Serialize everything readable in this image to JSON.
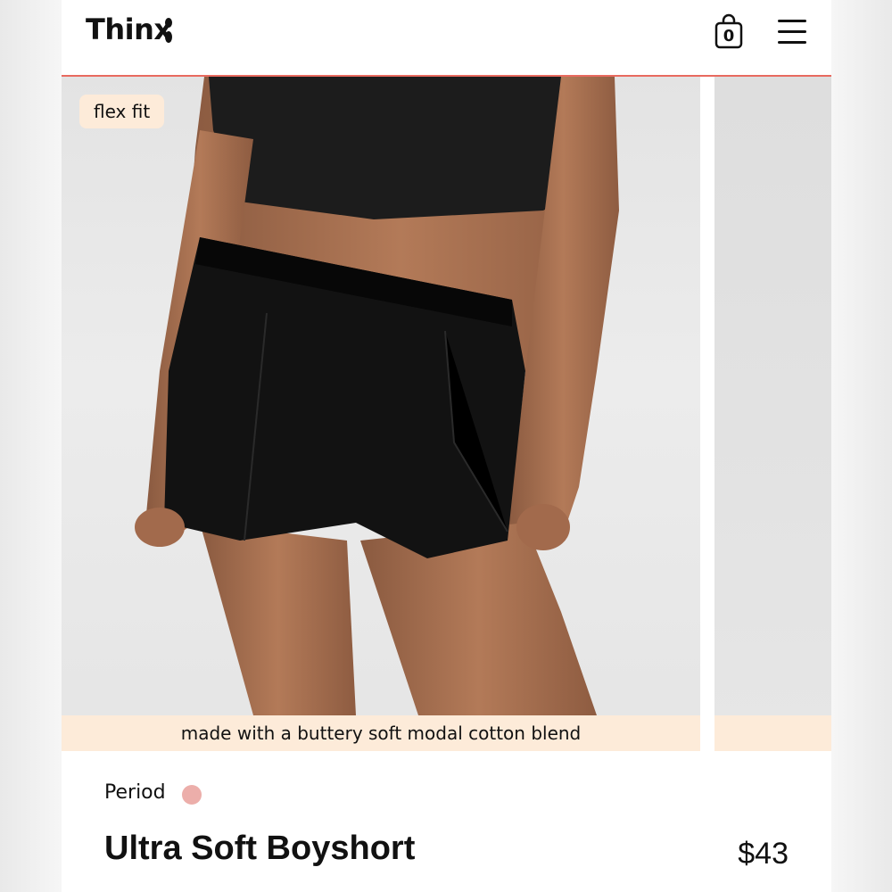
{
  "header": {
    "logo_text": "Thinx",
    "cart_count": "0",
    "accent_color": "#e86a5f"
  },
  "icons": {
    "cart": "shopping-bag-icon",
    "menu": "hamburger-menu-icon",
    "logo_mark": "thinx-logo-mark"
  },
  "product": {
    "badge": "flex fit",
    "caption": "made with a buttery soft modal cotton blend",
    "category": "Period",
    "swatch_color": "#ecaeaa",
    "title": "Ultra Soft Boyshort",
    "price": "$43"
  },
  "colors": {
    "caption_bg": "#fdebd9",
    "badge_bg": "#fdebd9"
  }
}
